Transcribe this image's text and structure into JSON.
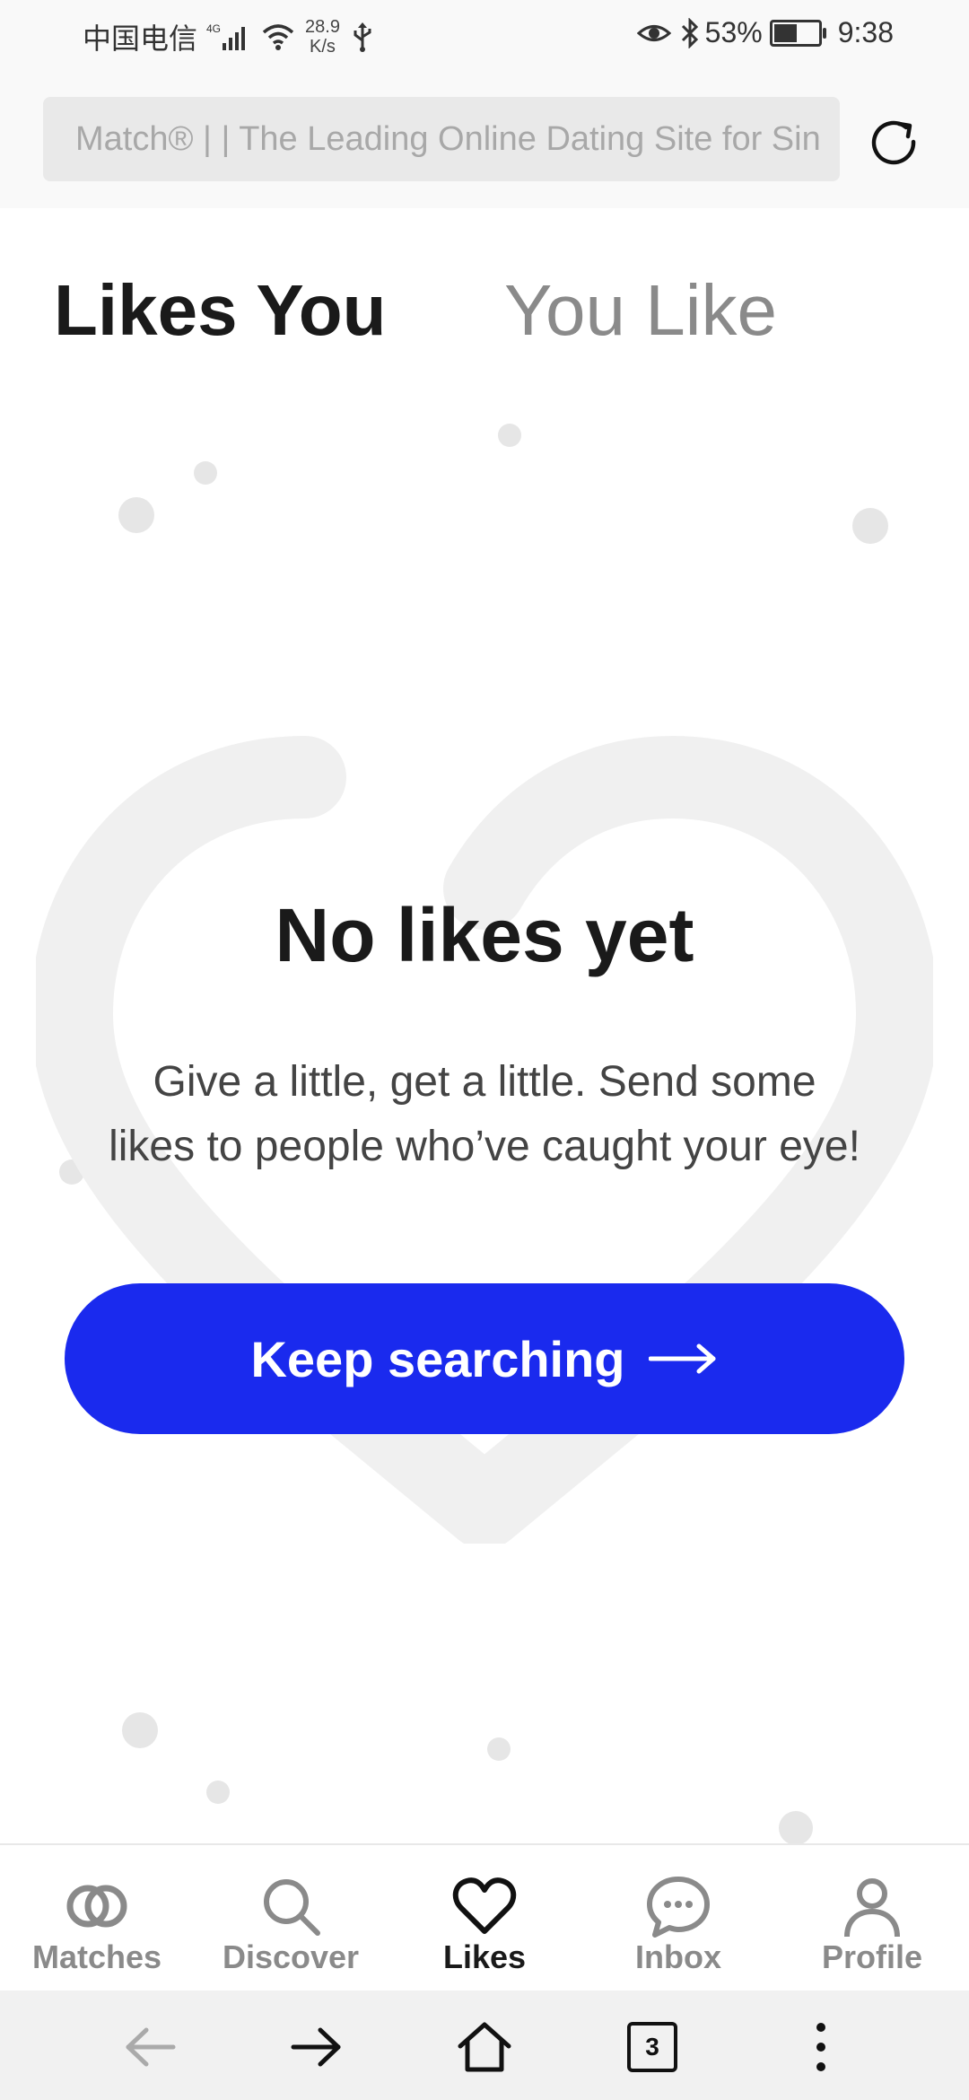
{
  "status_bar": {
    "carrier": "中国电信",
    "network": "4G",
    "speed_value": "28.9",
    "speed_unit": "K/s",
    "battery_percent": "53%",
    "battery_level": 0.53,
    "time": "9:38"
  },
  "browser": {
    "url_text": "Match® | | The Leading Online Dating Site for Sin",
    "tab_count": "3"
  },
  "tabs": [
    {
      "label": "Likes You",
      "active": true
    },
    {
      "label": "You Like",
      "active": false
    }
  ],
  "empty_state": {
    "title": "No likes yet",
    "description_line1": "Give a little, get a little. Send some",
    "description_line2": "likes to people who’ve caught your eye!",
    "cta_label": "Keep searching"
  },
  "bottom_nav": [
    {
      "label": "Matches",
      "icon": "matches-rings-icon",
      "active": false
    },
    {
      "label": "Discover",
      "icon": "search-icon",
      "active": false
    },
    {
      "label": "Likes",
      "icon": "heart-icon",
      "active": true
    },
    {
      "label": "Inbox",
      "icon": "chat-bubble-icon",
      "active": false
    },
    {
      "label": "Profile",
      "icon": "person-icon",
      "active": false
    }
  ],
  "colors": {
    "accent": "#1a2aee",
    "text_primary": "#1a1a1a",
    "text_muted": "#8a8a8a"
  }
}
